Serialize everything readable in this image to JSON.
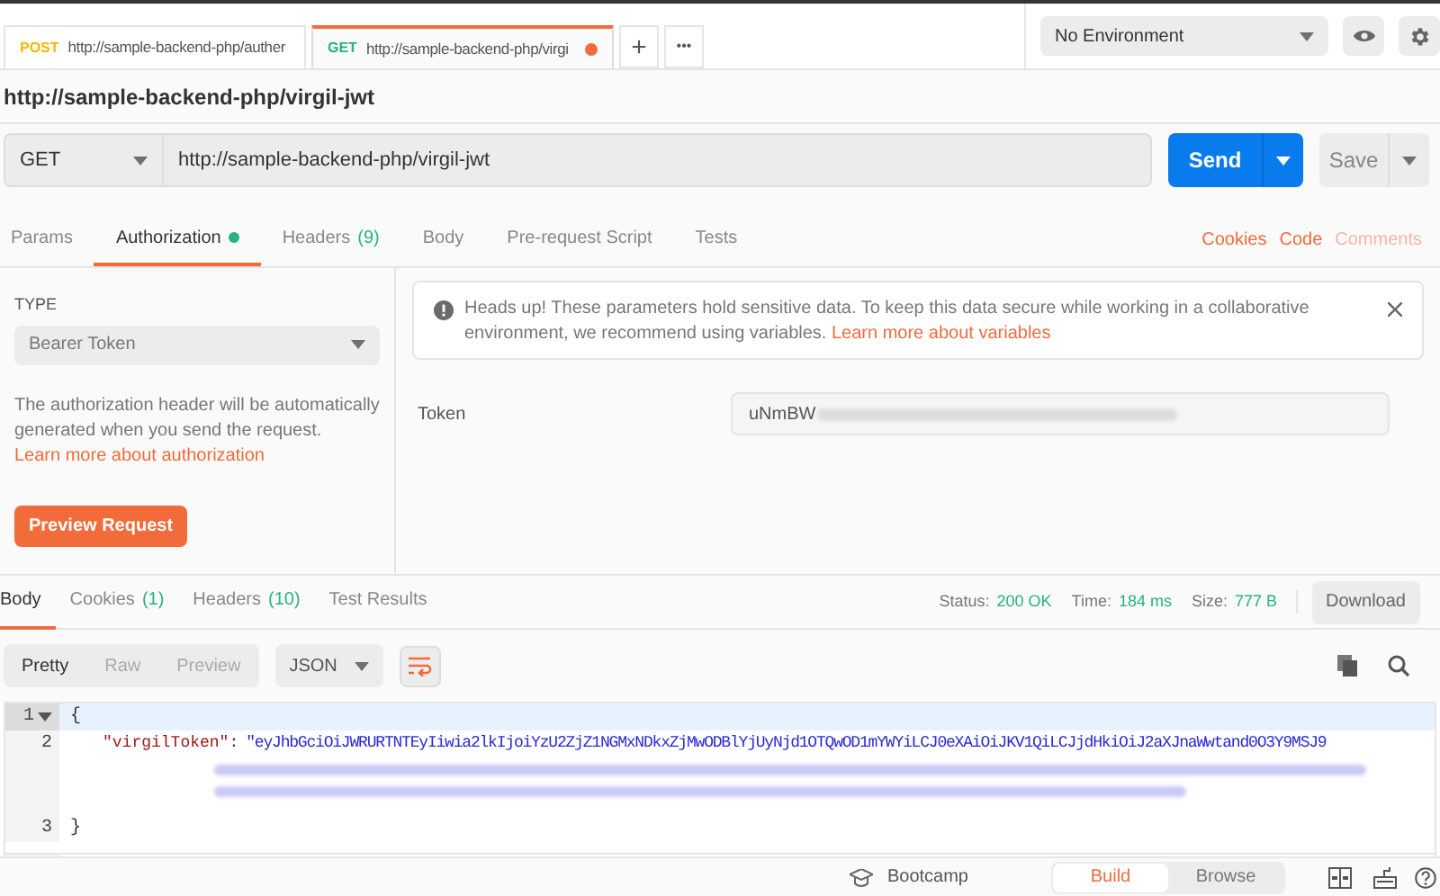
{
  "tabs": [
    {
      "method": "POST",
      "url": "http://sample-backend-php/auther",
      "selected": false,
      "unsaved": false
    },
    {
      "method": "GET",
      "url": "http://sample-backend-php/virgi",
      "selected": true,
      "unsaved": true
    }
  ],
  "tab_actions": {
    "new": "+",
    "more": "•••"
  },
  "environment": {
    "value": "No Environment"
  },
  "request": {
    "title": "http://sample-backend-php/virgil-jwt",
    "method": "GET",
    "url": "http://sample-backend-php/virgil-jwt",
    "send": "Send",
    "save": "Save"
  },
  "request_tabs": [
    {
      "label": "Params",
      "selected": false,
      "dot": false
    },
    {
      "label": "Authorization",
      "selected": true,
      "dot": true
    },
    {
      "label": "Headers",
      "count": "(9)",
      "selected": false,
      "dot": false
    },
    {
      "label": "Body",
      "selected": false,
      "dot": false
    },
    {
      "label": "Pre-request Script",
      "selected": false,
      "dot": false
    },
    {
      "label": "Tests",
      "selected": false,
      "dot": false
    }
  ],
  "request_links": [
    {
      "label": "Cookies",
      "disabled": false
    },
    {
      "label": "Code",
      "disabled": false
    },
    {
      "label": "Comments",
      "disabled": true
    }
  ],
  "auth": {
    "type_label": "TYPE",
    "type": "Bearer Token",
    "description": "The authorization header will be automatically generated when you send the request.",
    "description_link": "Learn more about authorization",
    "preview": "Preview Request",
    "notice": "Heads up! These parameters hold sensitive data. To keep this data secure while working in a collaborative environment, we recommend using variables.",
    "notice_link": "Learn more about variables",
    "token_label": "Token",
    "token_value": "uNmBW"
  },
  "response_tabs": [
    {
      "label": "Body",
      "selected": true
    },
    {
      "label": "Cookies",
      "count": "(1)",
      "selected": false
    },
    {
      "label": "Headers",
      "count": "(10)",
      "selected": false
    },
    {
      "label": "Test Results",
      "selected": false
    }
  ],
  "response_meta": [
    {
      "label": "Status:",
      "value": "200 OK"
    },
    {
      "label": "Time:",
      "value": "184 ms"
    },
    {
      "label": "Size:",
      "value": "777 B"
    }
  ],
  "download": "Download",
  "view_modes": [
    {
      "label": "Pretty",
      "selected": true
    },
    {
      "label": "Raw",
      "selected": false
    },
    {
      "label": "Preview",
      "selected": false
    }
  ],
  "format": "JSON",
  "code_lines": [
    {
      "number": "1",
      "text": "{",
      "kind": "plain"
    },
    {
      "number": "2",
      "key": "\"virgilToken\"",
      "colon": ":",
      "text": "\"eyJhbGciOiJWRURTNTEyIiwia2lkIjoiYzU2ZjZ1NGMxNDkxZjMwODBlYjUyNjd1OTQwOD1mYWYiLCJ0eXAiOiJKV1QiLCJjdHkiOiJ2aXJnaWwtand0O3Y9MSJ9",
      "kind": "pair"
    },
    {
      "number": "3",
      "text": "}",
      "kind": "plain"
    }
  ],
  "footer": {
    "bootcamp": "Bootcamp",
    "modes": [
      {
        "label": "Build",
        "selected": true
      },
      {
        "label": "Browse",
        "selected": false
      }
    ]
  }
}
